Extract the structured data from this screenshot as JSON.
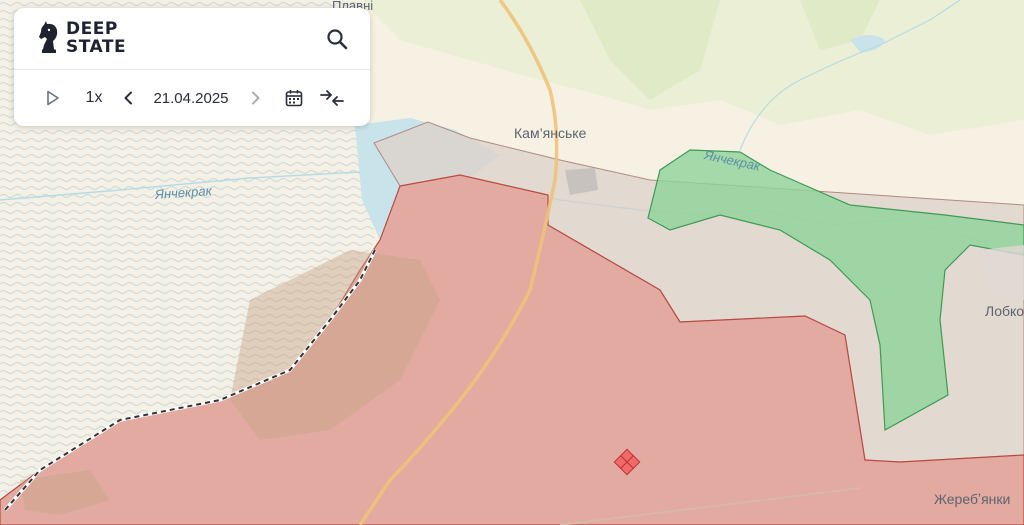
{
  "app": {
    "brand_line1": "DEEP",
    "brand_line2": "STATE"
  },
  "playback": {
    "speed": "1x",
    "date": "21.04.2025"
  },
  "icons": {
    "logo": "knight-chess-icon",
    "search": "search-icon",
    "play": "play-icon",
    "prev": "chevron-left-icon",
    "next": "chevron-right-icon",
    "calendar": "calendar-icon",
    "compare": "compare-arrows-icon"
  },
  "map": {
    "labels": {
      "town_kamianske": "Кам’янське",
      "town_lobkove": "Лобко",
      "town_zherebianky": "Жеребʼянки",
      "town_plavni": "Плавні",
      "river_west": "Янчекрак",
      "river_east": "Янчекрак"
    },
    "zones": [
      {
        "name": "occupied",
        "color": "#e2aaa0",
        "border": "#b84a42"
      },
      {
        "name": "liberated",
        "color": "#8fd39a",
        "border": "#3e9a55"
      },
      {
        "name": "contested",
        "color": "#ddd3cc",
        "border": "#b08a82"
      }
    ],
    "colors": {
      "land": "#f7f1e3",
      "water": "#c9e3ea",
      "road_major": "#f1c15a",
      "river": "#9ccfe0"
    }
  }
}
